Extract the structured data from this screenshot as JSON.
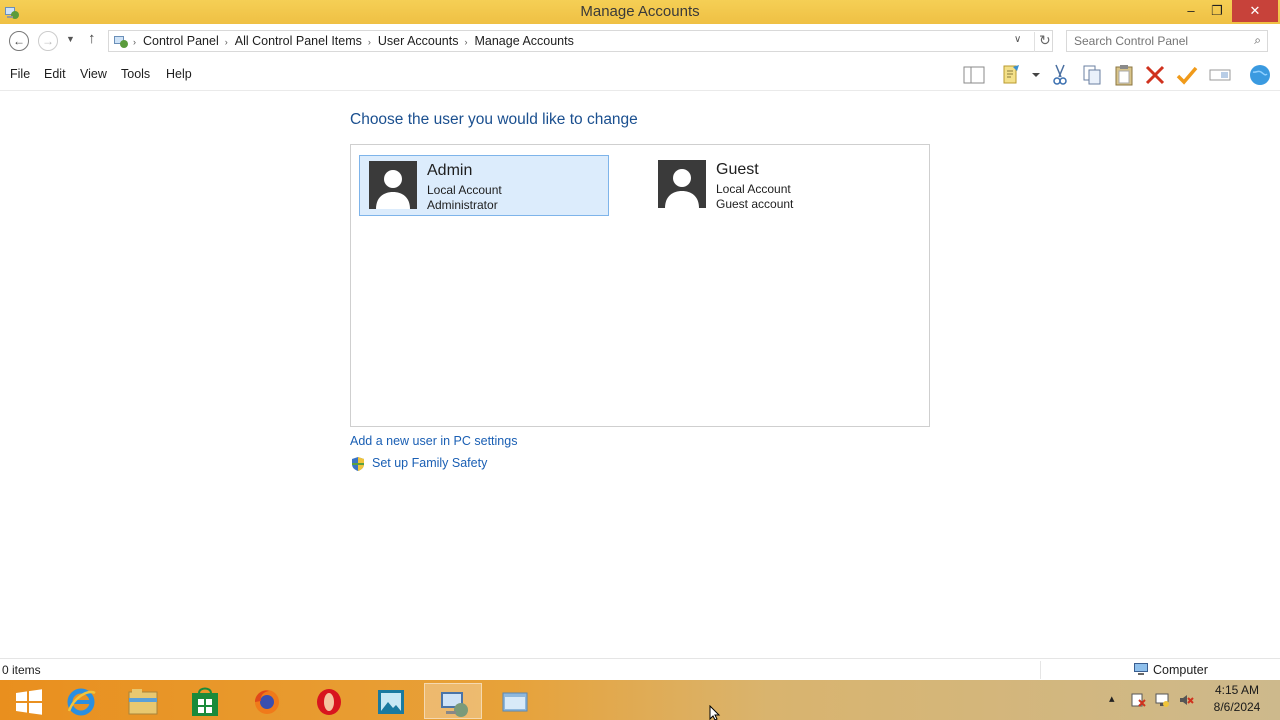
{
  "window": {
    "title": "Manage Accounts",
    "min_glyph": "–",
    "max_glyph": "❐",
    "close_glyph": "✕"
  },
  "navigation": {
    "back_glyph": "←",
    "forward_glyph": "→",
    "recent_glyph": "▼",
    "up_glyph": "↑",
    "breadcrumb": [
      "Control Panel",
      "All Control Panel Items",
      "User Accounts",
      "Manage Accounts"
    ],
    "sep_glyph": "›",
    "dropdown_glyph": "∨",
    "refresh_glyph": "↻",
    "search_placeholder": "Search Control Panel",
    "search_glyph": "⌕"
  },
  "menu": {
    "file": "File",
    "edit": "Edit",
    "view": "View",
    "tools": "Tools",
    "help": "Help"
  },
  "toolbar_icons": [
    "layout-pane-icon",
    "properties-icon",
    "cut-icon",
    "copy-icon",
    "paste-icon",
    "delete-icon",
    "check-icon",
    "rename-icon",
    "globe-icon"
  ],
  "main": {
    "heading": "Choose the user you would like to change",
    "accounts": [
      {
        "name": "Admin",
        "type": "Local Account",
        "role": "Administrator",
        "selected": true
      },
      {
        "name": "Guest",
        "type": "Local Account",
        "role": "Guest account",
        "selected": false
      }
    ],
    "add_user_link": "Add a new user in PC settings",
    "family_safety_link": "Set up Family Safety"
  },
  "status": {
    "items": "0 items",
    "location": "Computer"
  },
  "taskbar": {
    "apps": [
      "start-icon",
      "internet-explorer-icon",
      "file-explorer-icon",
      "store-icon",
      "firefox-icon",
      "opera-icon",
      "photos-icon",
      "control-panel-icon",
      "window-icon"
    ],
    "time": "4:15 AM",
    "date": "8/6/2024",
    "tray_up_glyph": "▴"
  },
  "colors": {
    "titlebar": "#f2c94c",
    "close": "#c7423a",
    "heading": "#1a4f8f",
    "link": "#1a5fb4",
    "selection": "#dcecfc",
    "taskbar": "#e98f1e"
  }
}
